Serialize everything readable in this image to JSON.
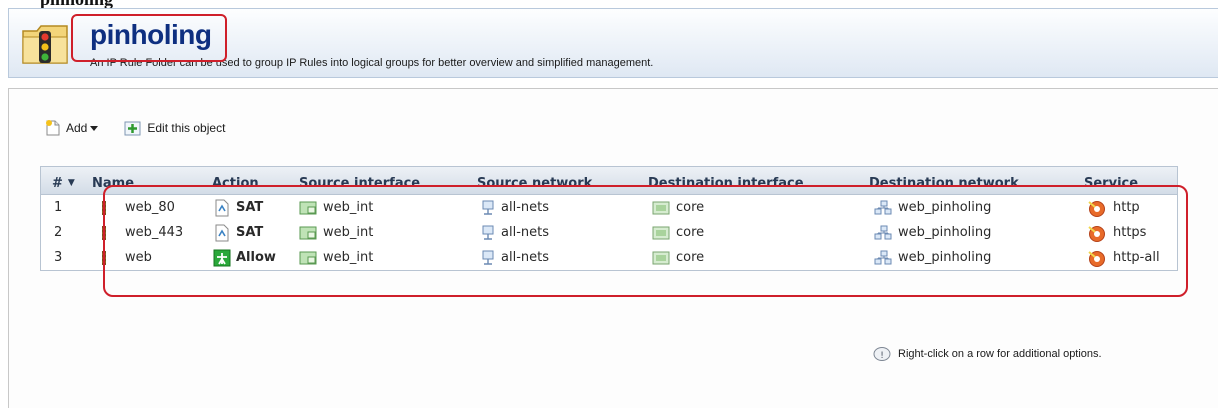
{
  "top_caption": "pinholing",
  "header": {
    "title": "pinholing",
    "description": "An IP Rule Folder can be used to group IP Rules into logical groups for better overview and simplified management."
  },
  "toolbar": {
    "add_label": "Add",
    "edit_label": "Edit this object"
  },
  "grid": {
    "columns": [
      "#",
      "Name",
      "Action",
      "Source interface",
      "Source network",
      "Destination interface",
      "Destination network",
      "Service"
    ],
    "rows": [
      {
        "index": "1",
        "name": "web_80",
        "action": "SAT",
        "action_icon": "sat-icon",
        "src_if": "web_int",
        "src_net": "all-nets",
        "dst_if": "core",
        "dst_net": "web_pinholing",
        "service": "http"
      },
      {
        "index": "2",
        "name": "web_443",
        "action": "SAT",
        "action_icon": "sat-icon",
        "src_if": "web_int",
        "src_net": "all-nets",
        "dst_if": "core",
        "dst_net": "web_pinholing",
        "service": "https"
      },
      {
        "index": "3",
        "name": "web",
        "action": "Allow",
        "action_icon": "allow-icon",
        "src_if": "web_int",
        "src_net": "all-nets",
        "dst_if": "core",
        "dst_net": "web_pinholing",
        "service": "http-all"
      }
    ]
  },
  "hint": "Right-click on a row for additional options.",
  "colors": {
    "title": "#0e2f80",
    "highlight": "#cf1f2a",
    "header_grad_top": "#edf1f6",
    "header_grad_bottom": "#d3dce7"
  }
}
